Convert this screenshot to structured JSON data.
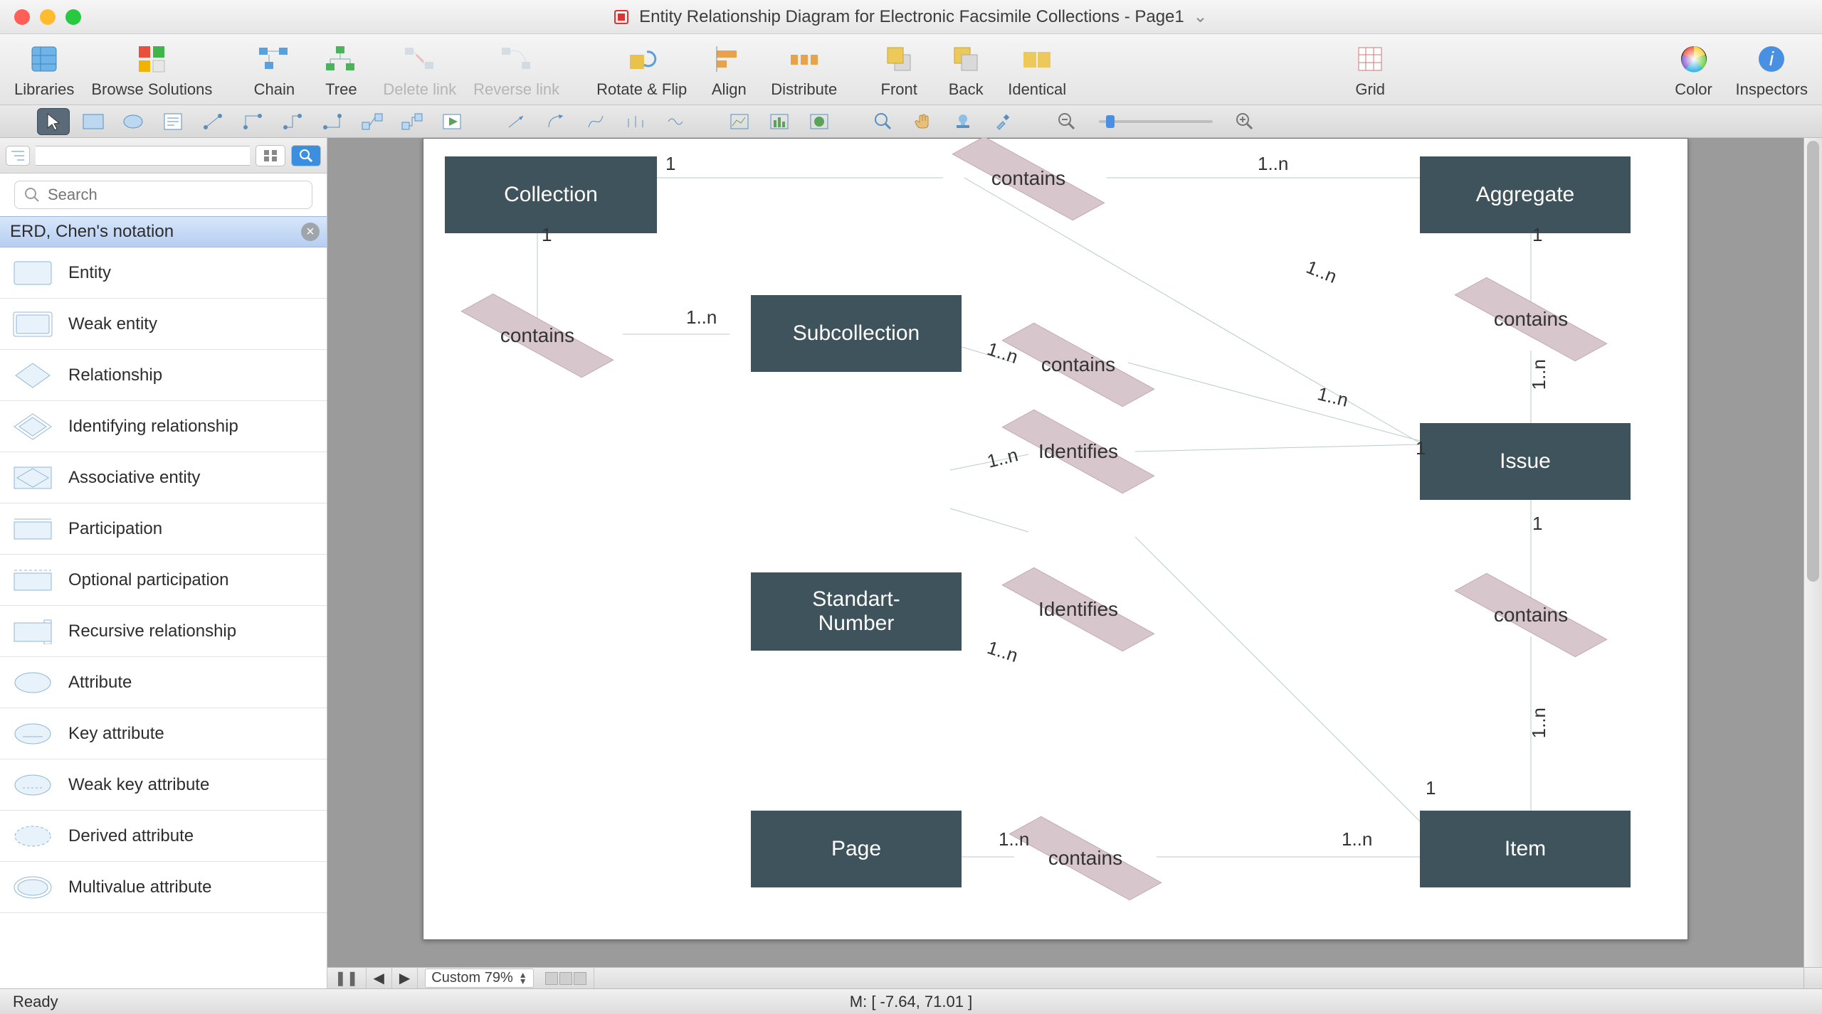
{
  "title": "Entity Relationship Diagram for Electronic Facsimile Collections - Page1",
  "toolbar": {
    "libraries": "Libraries",
    "browse": "Browse Solutions",
    "chain": "Chain",
    "tree": "Tree",
    "delete_link": "Delete link",
    "reverse_link": "Reverse link",
    "rotate": "Rotate & Flip",
    "align": "Align",
    "distribute": "Distribute",
    "front": "Front",
    "back": "Back",
    "identical": "Identical",
    "grid": "Grid",
    "color": "Color",
    "inspectors": "Inspectors"
  },
  "left": {
    "search_placeholder": "Search",
    "category": "ERD, Chen's notation",
    "stencils": [
      "Entity",
      "Weak entity",
      "Relationship",
      "Identifying relationship",
      "Associative entity",
      "Participation",
      "Optional participation",
      "Recursive relationship",
      "Attribute",
      "Key attribute",
      "Weak key attribute",
      "Derived attribute",
      "Multivalue attribute"
    ]
  },
  "diagram": {
    "entities": {
      "collection": "Collection",
      "aggregate": "Aggregate",
      "subcollection": "Subcollection",
      "issue": "Issue",
      "standartnumber": "Standart-\nNumber",
      "page": "Page",
      "item": "Item"
    },
    "relations": {
      "contains": "contains",
      "identifies": "Identifies"
    },
    "card": {
      "one": "1",
      "one_n": "1..n"
    }
  },
  "bottombar": {
    "zoom_label": "Custom 79%"
  },
  "status": {
    "ready": "Ready",
    "mouse": "M: [ -7.64, 71.01 ]"
  }
}
